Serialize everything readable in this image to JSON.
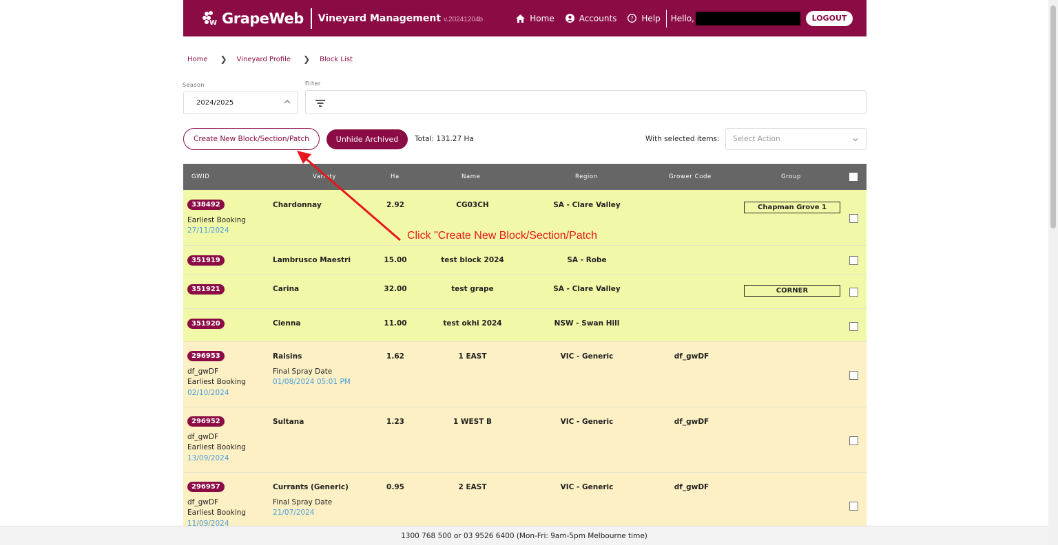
{
  "header": {
    "logo_text": "GrapeWeb",
    "app_name": "Vineyard Management",
    "version": "v.20241204b",
    "nav": {
      "home": "Home",
      "accounts": "Accounts",
      "help": "Help",
      "hello": "Hello,"
    },
    "logout": "LOGOUT"
  },
  "breadcrumb": [
    "Home",
    "Vineyard Profile",
    "Block List"
  ],
  "season": {
    "label": "Season",
    "value": "2024/2025"
  },
  "filter": {
    "label": "Filter"
  },
  "actions": {
    "create": "Create New Block/Section/Patch",
    "unhide": "Unhide Archived",
    "total": "Total: 131.27 Ha",
    "with_selected": "With selected items:",
    "select_action_placeholder": "Select Action"
  },
  "table": {
    "headers": {
      "gwid": "GWID",
      "variety": "Variety",
      "ha": "Ha",
      "name": "Name",
      "region": "Region",
      "grower_code": "Grower Code",
      "group": "Group"
    },
    "rows": [
      {
        "gwid": "338492",
        "variety": "Chardonnay",
        "ha": "2.92",
        "name": "CG03CH",
        "region": "SA - Clare Valley",
        "grower_code": "",
        "group": "Chapman Grove 1",
        "sub_label": "Earliest Booking",
        "sub_date": "27/11/2024"
      },
      {
        "gwid": "351919",
        "variety": "Lambrusco Maestri",
        "ha": "15.00",
        "name": "test block 2024",
        "region": "SA - Robe",
        "grower_code": "",
        "group": ""
      },
      {
        "gwid": "351921",
        "variety": "Carina",
        "ha": "32.00",
        "name": "test grape",
        "region": "SA - Clare Valley",
        "grower_code": "",
        "group": "CORNER"
      },
      {
        "gwid": "351920",
        "variety": "Cienna",
        "ha": "11.00",
        "name": "test okhi 2024",
        "region": "NSW - Swan Hill",
        "grower_code": "",
        "group": ""
      },
      {
        "gwid": "296953",
        "variety": "Raisins",
        "ha": "1.62",
        "name": "1 EAST",
        "region": "VIC - Generic",
        "grower_code": "df_gwDF",
        "group": "",
        "gwid_sub": "df_gwDF",
        "sub_label": "Earliest Booking",
        "sub_date": "02/10/2024",
        "spray_label": "Final Spray Date",
        "spray_date": "01/08/2024 05:01 PM"
      },
      {
        "gwid": "296952",
        "variety": "Sultana",
        "ha": "1.23",
        "name": "1 WEST B",
        "region": "VIC - Generic",
        "grower_code": "df_gwDF",
        "group": "",
        "gwid_sub": "df_gwDF",
        "sub_label": "Earliest Booking",
        "sub_date": "13/09/2024"
      },
      {
        "gwid": "296957",
        "variety": "Currants (Generic)",
        "ha": "0.95",
        "name": "2 EAST",
        "region": "VIC - Generic",
        "grower_code": "df_gwDF",
        "group": "",
        "gwid_sub": "df_gwDF",
        "sub_label": "Earliest Booking",
        "sub_date": "11/09/2024",
        "spray_label": "Final Spray Date",
        "spray_date": "21/07/2024"
      }
    ]
  },
  "annotation": "Click \"Create New Block/Section/Patch",
  "footer": "1300 768 500 or 03 9526 6400 (Mon-Fri: 9am-5pm Melbourne time)",
  "colors": {
    "brand": "#8b0b45",
    "row_green": "#f1f9a8",
    "row_cream": "#fdf0c4",
    "link_blue": "#4a9fe0",
    "annotation_red": "#e8151b"
  }
}
